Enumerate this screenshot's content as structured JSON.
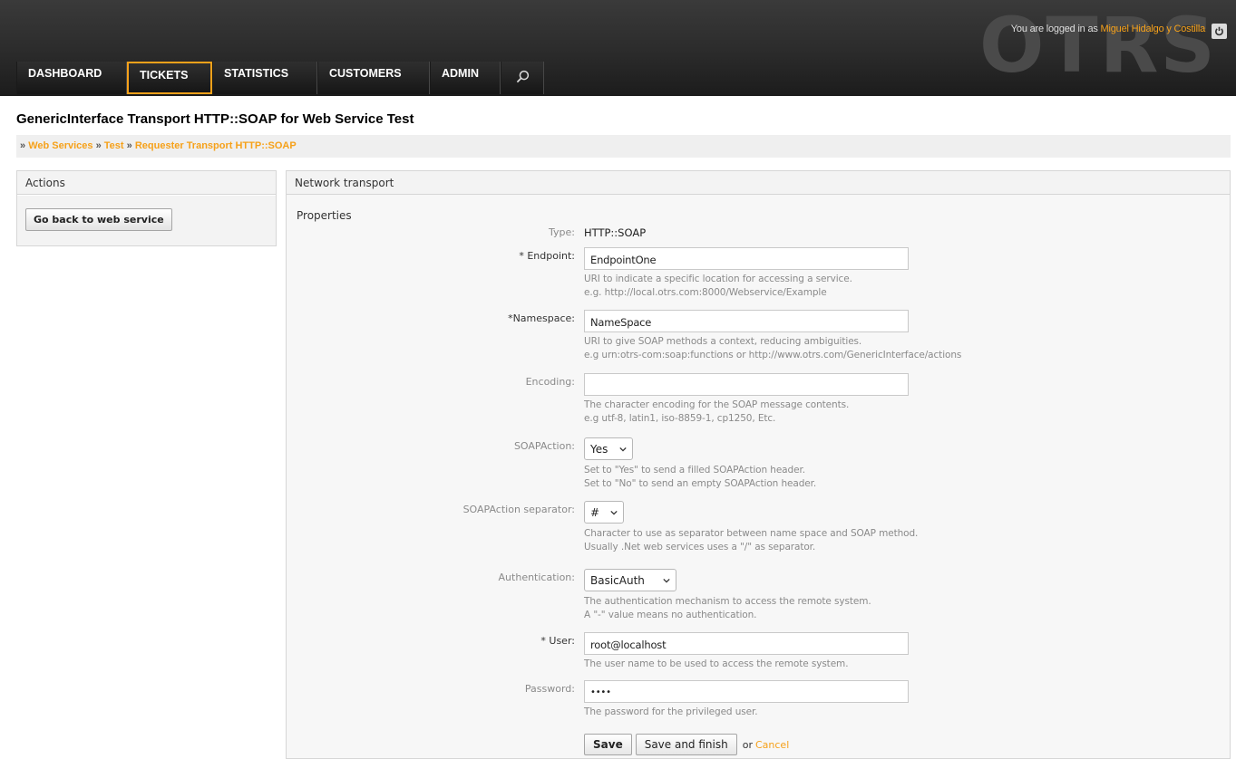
{
  "header": {
    "logo": "OTRS",
    "login_prefix": "You are logged in as",
    "user_name": "Miguel Hidalgo y Costilla",
    "logout_icon": "power-icon"
  },
  "nav": {
    "items": [
      {
        "label": "DASHBOARD"
      },
      {
        "label": "TICKETS"
      },
      {
        "label": "STATISTICS"
      },
      {
        "label": "CUSTOMERS"
      },
      {
        "label": "ADMIN"
      }
    ],
    "search_icon": "search-icon",
    "active": "TICKETS"
  },
  "page": {
    "title": "GenericInterface Transport HTTP::SOAP for Web Service Test"
  },
  "breadcrumb": {
    "sep": "»",
    "items": [
      "Web Services",
      "Test",
      "Requester Transport HTTP::SOAP"
    ]
  },
  "sidebar": {
    "title": "Actions",
    "back_button": "Go back to web service"
  },
  "content": {
    "title": "Network transport",
    "properties_title": "Properties",
    "type_label": "Type:",
    "type_value": "HTTP::SOAP",
    "endpoint": {
      "label": "* Endpoint:",
      "value": "EndpointOne",
      "hint1": "URI to indicate a specific location for accessing a service.",
      "hint2": "e.g. http://local.otrs.com:8000/Webservice/Example"
    },
    "namespace": {
      "label": "*Namespace:",
      "value": "NameSpace",
      "hint1": "URI to give SOAP methods a context, reducing ambiguities.",
      "hint2": "e.g urn:otrs-com:soap:functions or http://www.otrs.com/GenericInterface/actions"
    },
    "encoding": {
      "label": "Encoding:",
      "value": "",
      "hint1": "The character encoding for the SOAP message contents.",
      "hint2": "e.g utf-8, latin1, iso-8859-1, cp1250, Etc."
    },
    "soapaction": {
      "label": "SOAPAction:",
      "value": "Yes",
      "hint1": "Set to \"Yes\" to send a filled SOAPAction header.",
      "hint2": "Set to \"No\" to send an empty SOAPAction header."
    },
    "separator": {
      "label": "SOAPAction separator:",
      "value": "#",
      "hint1": "Character to use as separator between name space and SOAP method.",
      "hint2": "Usually .Net web services uses a \"/\" as separator."
    },
    "authentication": {
      "label": "Authentication:",
      "value": "BasicAuth",
      "hint1": "The authentication mechanism to access the remote system.",
      "hint2": "A \"-\" value means no authentication."
    },
    "user": {
      "label": "* User:",
      "value": "root@localhost",
      "hint1": "The user name to be used to access the remote system."
    },
    "password": {
      "label": "Password:",
      "value": "••••",
      "hint1": "The password for the privileged user."
    },
    "save_label": "Save",
    "save_finish_label": "Save and finish",
    "or_label": "or",
    "cancel_label": "Cancel"
  }
}
